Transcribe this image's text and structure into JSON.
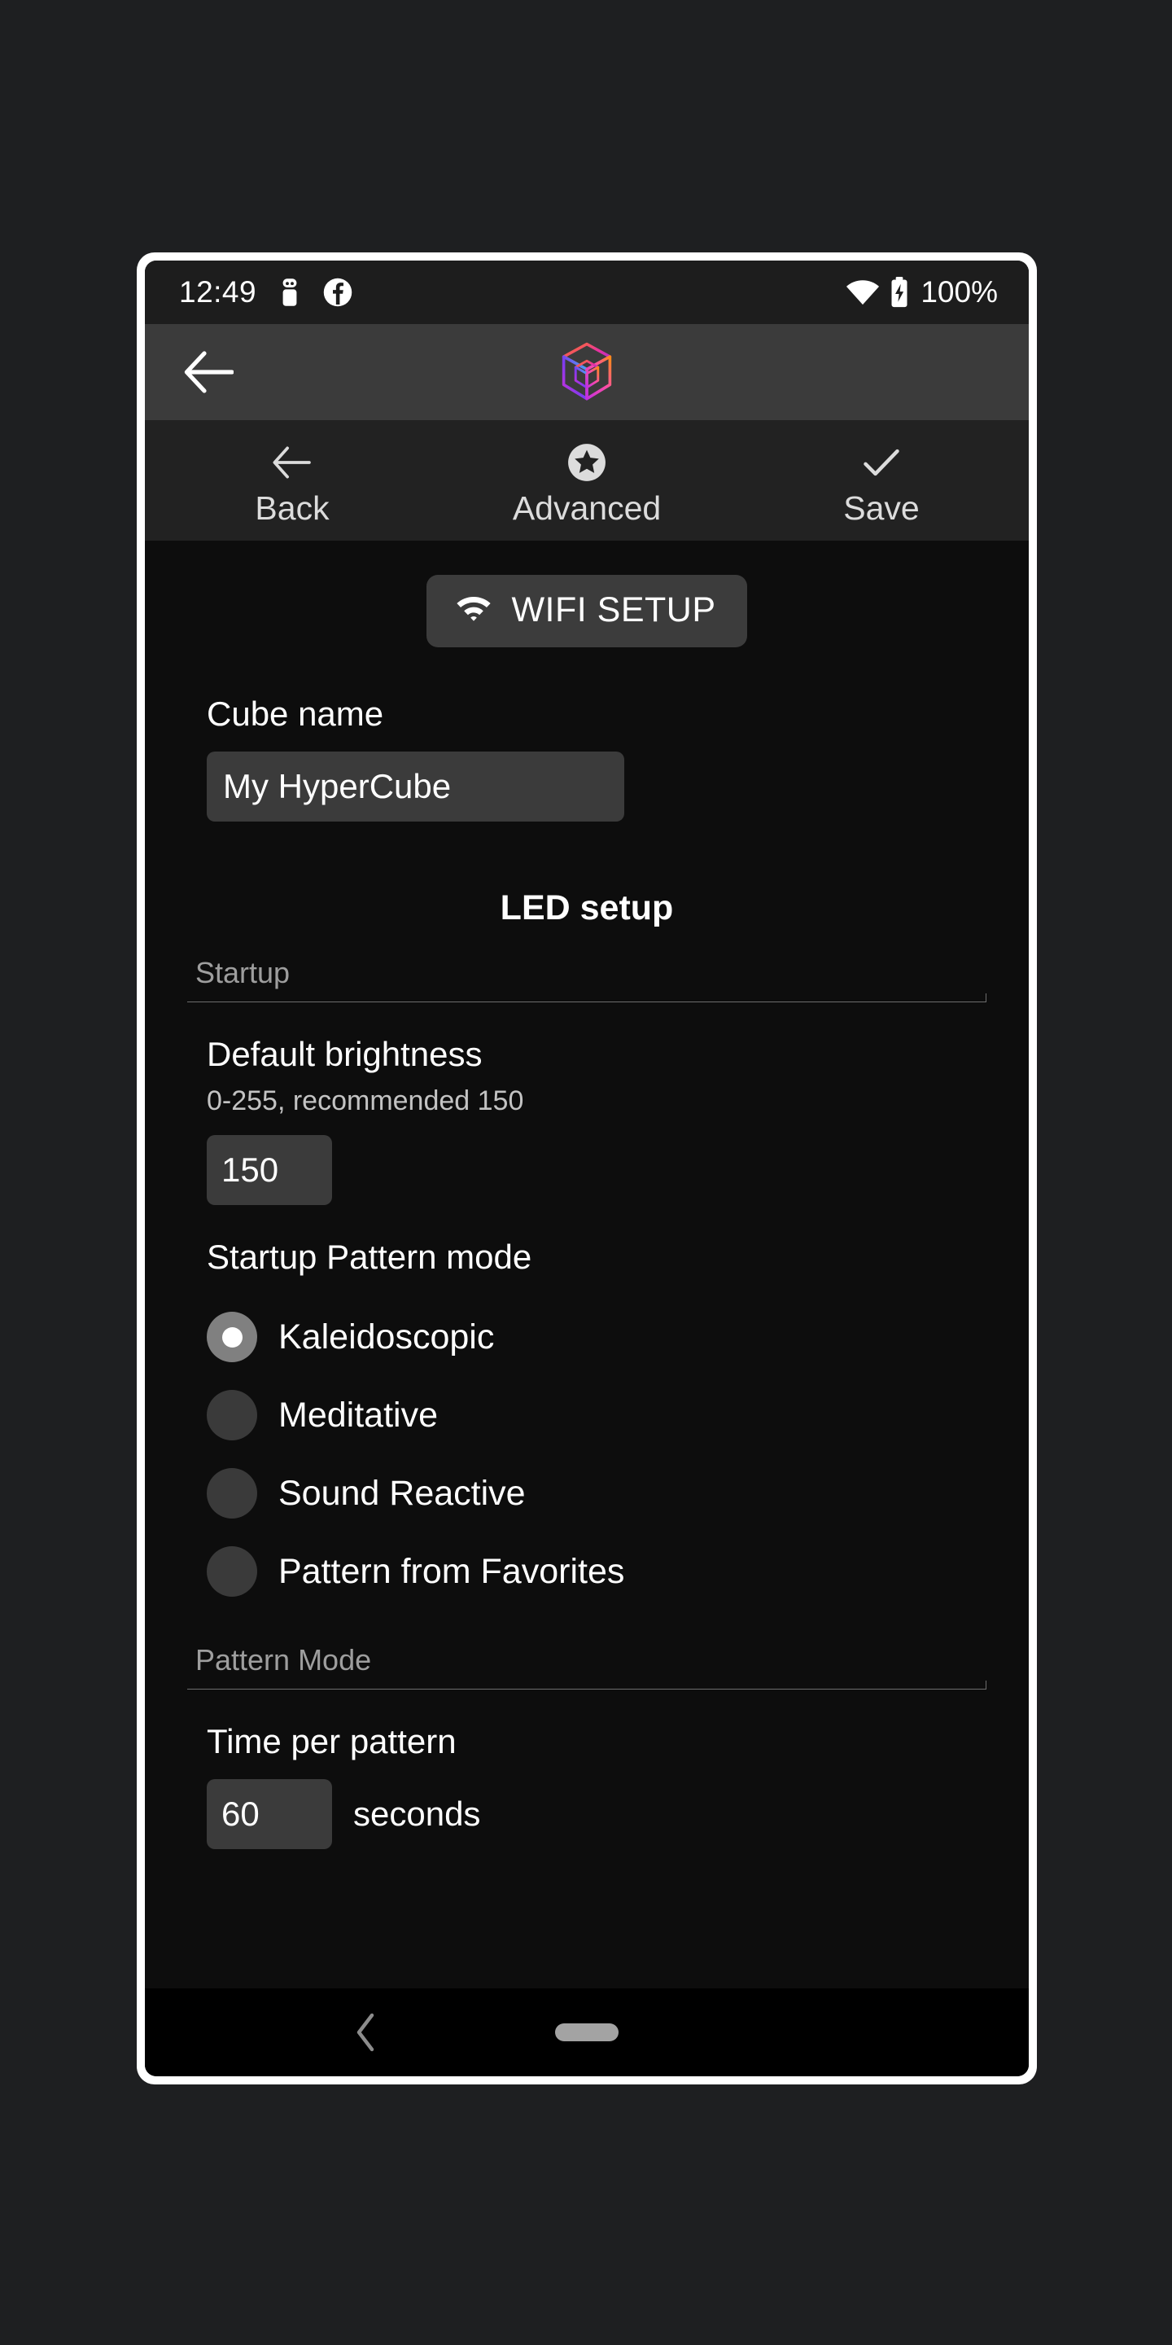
{
  "status_bar": {
    "time": "12:49",
    "battery_percent": "100%",
    "icons": [
      "usb-debug-icon",
      "facebook-icon",
      "wifi-icon",
      "battery-charging-icon"
    ]
  },
  "app_bar": {
    "back_icon": "arrow-left-icon",
    "logo": "hypercube-logo"
  },
  "toolbar": {
    "items": [
      {
        "label": "Back",
        "icon": "arrow-left-icon"
      },
      {
        "label": "Advanced",
        "icon": "star-circle-icon"
      },
      {
        "label": "Save",
        "icon": "check-icon"
      }
    ]
  },
  "content": {
    "wifi_setup": {
      "label": "WIFI SETUP",
      "icon": "wifi-icon"
    },
    "cube_name": {
      "label": "Cube name",
      "value": "My HyperCube",
      "placeholder": "Cube name"
    },
    "led_setup": {
      "title": "LED setup",
      "startup_section": {
        "legend": "Startup",
        "default_brightness": {
          "title": "Default brightness",
          "hint": "0-255, recommended 150",
          "value": "150",
          "placeholder": "150"
        },
        "startup_pattern_mode": {
          "title": "Startup Pattern mode",
          "selected": "Kaleidoscopic",
          "options": [
            "Kaleidoscopic",
            "Meditative",
            "Sound Reactive",
            "Pattern from Favorites"
          ]
        }
      },
      "pattern_mode_section": {
        "legend": "Pattern Mode",
        "time_per_pattern": {
          "title": "Time per pattern",
          "value": "60",
          "placeholder": "60",
          "unit": "seconds"
        }
      }
    }
  },
  "nav_bar": {
    "back_icon": "chevron-left-icon",
    "home_icon": "home-pill-icon"
  },
  "colors": {
    "page_background": "#1e1f21",
    "frame": "#ffffff",
    "status_bar": "#1d1d1d",
    "app_bar": "#3b3b3b",
    "toolbar": "#222222",
    "content": "#0d0d0d",
    "input": "#3b3b3b",
    "radio_selected": "#808080",
    "radio_unselected": "#3a3a3a",
    "divider": "#6d6d6d",
    "nav_bar": "#000000",
    "logo_gradient_start": "#ff7a18",
    "logo_gradient_mid": "#e832a0",
    "logo_gradient_end": "#33c7f5"
  }
}
